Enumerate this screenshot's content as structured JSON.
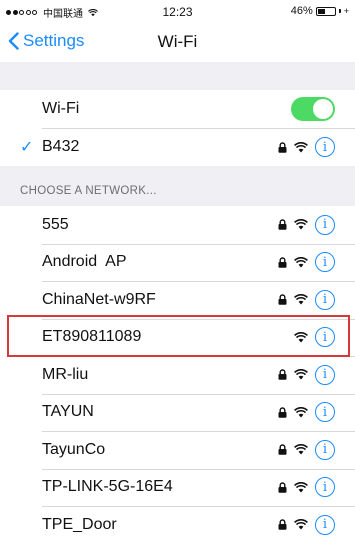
{
  "status": {
    "carrier": "中国联通",
    "time": "12:23",
    "battery_percent": "46%",
    "battery_level": 0.46
  },
  "nav": {
    "back_label": "Settings",
    "title": "Wi-Fi"
  },
  "wifi_toggle": {
    "label": "Wi-Fi",
    "on": true
  },
  "connected": {
    "name": "B432",
    "secured": true
  },
  "section": {
    "header": "CHOOSE A NETWORK..."
  },
  "networks": [
    {
      "name": "555",
      "secured": true
    },
    {
      "name": "Android  AP",
      "secured": true
    },
    {
      "name": "ChinaNet-w9RF",
      "secured": true
    },
    {
      "name": "ET890811089",
      "secured": false,
      "highlighted": true
    },
    {
      "name": "MR-liu",
      "secured": true
    },
    {
      "name": "TAYUN",
      "secured": true
    },
    {
      "name": "TayunCo",
      "secured": true
    },
    {
      "name": "TP-LINK-5G-16E4",
      "secured": true
    },
    {
      "name": "TPE_Door",
      "secured": true
    }
  ],
  "colors": {
    "accent": "#1a8cff",
    "toggle_on": "#4cd964",
    "highlight": "#d43a3a"
  },
  "icons": {
    "info": "info-icon",
    "lock": "lock-icon",
    "wifi": "wifi-signal-icon",
    "check": "checkmark-icon"
  }
}
